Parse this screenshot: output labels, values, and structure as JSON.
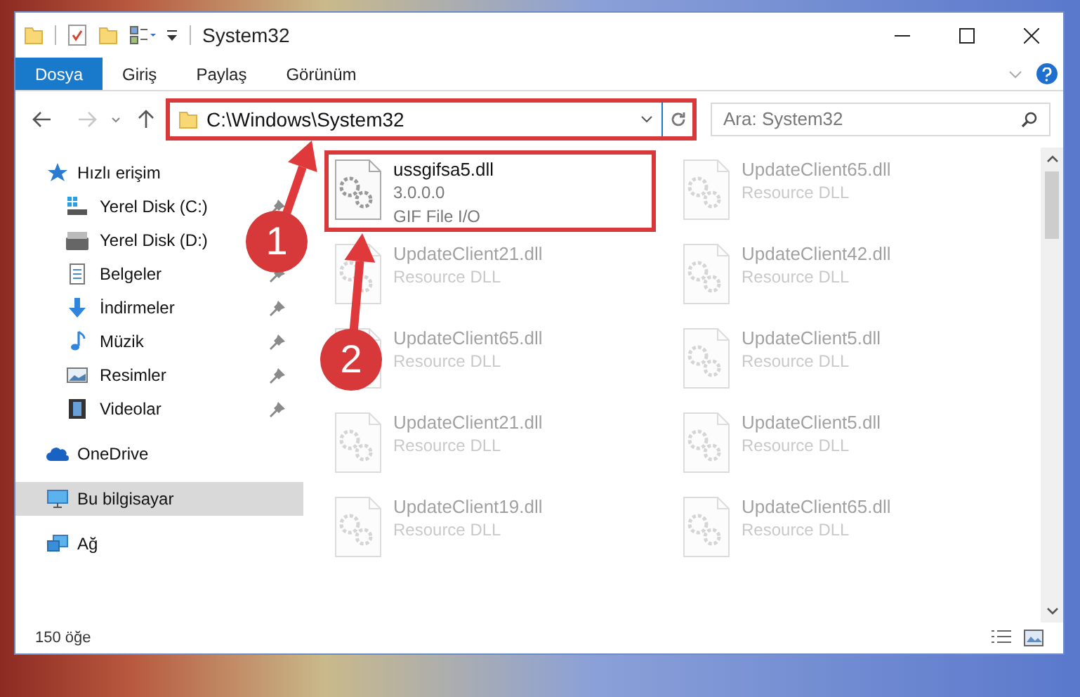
{
  "window": {
    "title": "System32"
  },
  "ribbon": {
    "tabs": [
      {
        "label": "Dosya",
        "selected": true
      },
      {
        "label": "Giriş",
        "selected": false
      },
      {
        "label": "Paylaş",
        "selected": false
      },
      {
        "label": "Görünüm",
        "selected": false
      }
    ]
  },
  "address_bar": {
    "path": "C:\\Windows\\System32",
    "highlighted": true
  },
  "search": {
    "placeholder": "Ara: System32"
  },
  "sidebar": {
    "items": [
      {
        "label": "Hızlı erişim",
        "kind": "star",
        "selected": false,
        "children": [
          {
            "label": "Yerel Disk (C:)",
            "kind": "system-drive",
            "pinned": true
          },
          {
            "label": "Yerel Disk (D:)",
            "kind": "drive",
            "pinned": false
          },
          {
            "label": "Belgeler",
            "kind": "documents",
            "pinned": true
          },
          {
            "label": "İndirmeler",
            "kind": "downloads",
            "pinned": true
          },
          {
            "label": "Müzik",
            "kind": "music",
            "pinned": true
          },
          {
            "label": "Resimler",
            "kind": "pictures",
            "pinned": true
          },
          {
            "label": "Videolar",
            "kind": "videos",
            "pinned": true
          }
        ]
      },
      {
        "label": "OneDrive",
        "kind": "cloud",
        "selected": false
      },
      {
        "label": "Bu bilgisayar",
        "kind": "computer",
        "selected": true
      },
      {
        "label": "Ağ",
        "kind": "network",
        "selected": false
      }
    ]
  },
  "files": [
    {
      "name": "ussgifsa5.dll",
      "version": "3.0.0.0",
      "description": "GIF File I/O",
      "highlighted": true,
      "faded": false
    },
    {
      "name": "UpdateClient65.dll",
      "description": "Resource DLL",
      "highlighted": false,
      "faded": true
    },
    {
      "name": "UpdateClient21.dll",
      "description": "Resource DLL",
      "highlighted": false,
      "faded": true
    },
    {
      "name": "UpdateClient42.dll",
      "description": "Resource DLL",
      "highlighted": false,
      "faded": true
    },
    {
      "name": "UpdateClient65.dll",
      "description": "Resource DLL",
      "highlighted": false,
      "faded": true
    },
    {
      "name": "UpdateClient5.dll",
      "description": "Resource DLL",
      "highlighted": false,
      "faded": true
    },
    {
      "name": "UpdateClient21.dll",
      "description": "Resource DLL",
      "highlighted": false,
      "faded": true
    },
    {
      "name": "UpdateClient5.dll",
      "description": "Resource DLL",
      "highlighted": false,
      "faded": true
    },
    {
      "name": "UpdateClient19.dll",
      "description": "Resource DLL",
      "highlighted": false,
      "faded": true
    },
    {
      "name": "UpdateClient65.dll",
      "description": "Resource DLL",
      "highlighted": false,
      "faded": true
    }
  ],
  "status_bar": {
    "item_count": "150 öğe"
  },
  "annotations": [
    {
      "label": "1"
    },
    {
      "label": "2"
    }
  ]
}
